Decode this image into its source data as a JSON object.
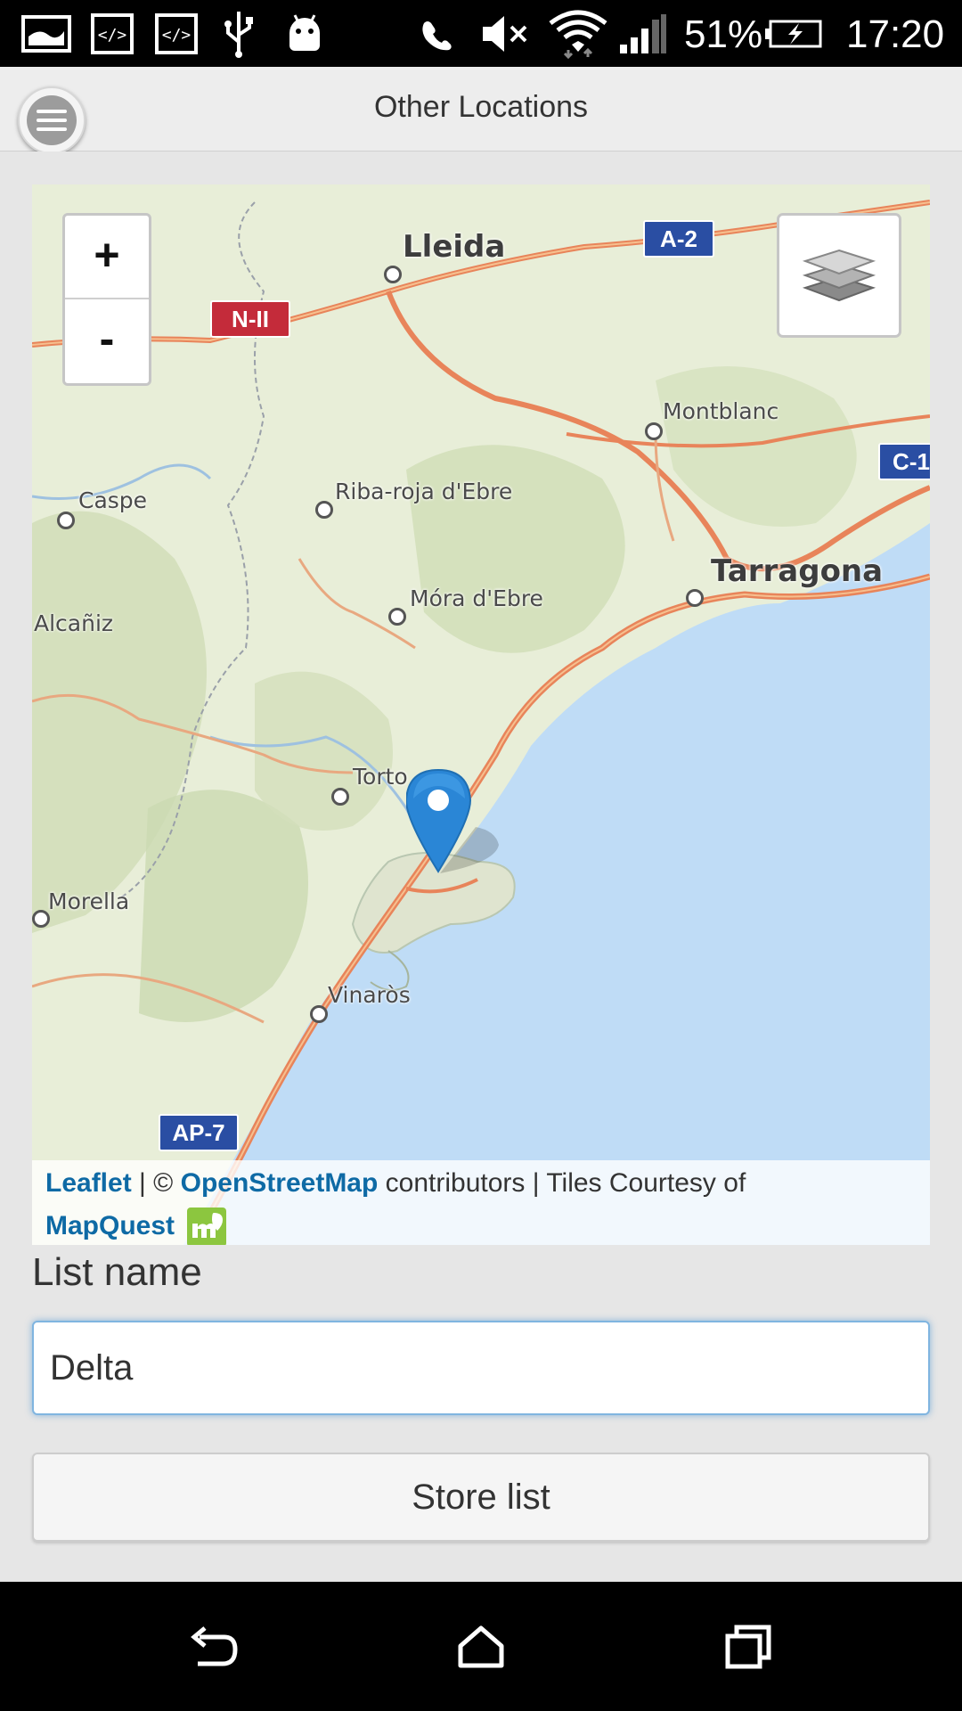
{
  "status_bar": {
    "battery": "51%",
    "time": "17:20",
    "icons": [
      "image-icon",
      "code-icon",
      "code-icon",
      "usb-icon",
      "android-icon",
      "phone-icon",
      "mute-icon",
      "wifi-icon",
      "signal-icon",
      "battery-charging-icon"
    ]
  },
  "header": {
    "title": "Other Locations",
    "menu_icon": "menu-icon"
  },
  "map": {
    "zoom_in": "+",
    "zoom_out": "-",
    "layers_icon": "layers-icon",
    "marker_icon": "map-marker-icon",
    "places": {
      "lleida": "Lleida",
      "montblanc": "Montblanc",
      "caspe": "Caspe",
      "ribaroja": "Riba-roja d'Ebre",
      "tarragona": "Tarragona",
      "mora": "Móra d'Ebre",
      "alcaniz": "Alcañiz",
      "tortosa": "Torto",
      "morella": "Morella",
      "vinaros": "Vinaròs"
    },
    "roads": {
      "a2": "A-2",
      "n2": "N-II",
      "c1": "C-1",
      "ap7": "AP-7"
    },
    "attribution": {
      "leaflet": "Leaflet",
      "sep1": " | © ",
      "osm": "OpenStreetMap",
      "contributors": " contributors | Tiles Courtesy of",
      "mapquest": "MapQuest"
    },
    "colors": {
      "land": "#e9eed9",
      "sea": "#bfdcf6",
      "road": "#e8845a",
      "marker": "#2a86d6"
    }
  },
  "form": {
    "list_label": "List name",
    "list_value": "Delta",
    "store_button": "Store list"
  },
  "nav_bar": {
    "back_icon": "back-icon",
    "home_icon": "home-icon",
    "recents_icon": "recents-icon"
  }
}
